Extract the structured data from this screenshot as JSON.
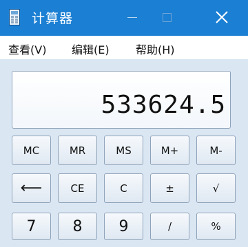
{
  "titlebar": {
    "title": "计算器",
    "icon": "calculator-icon",
    "minimize_icon": "minimize-icon",
    "maximize_icon": "maximize-icon",
    "close_icon": "close-icon"
  },
  "menu": {
    "items": [
      {
        "label": "查看(V)"
      },
      {
        "label": "编辑(E)"
      },
      {
        "label": "帮助(H)"
      }
    ]
  },
  "display": {
    "value": "533624.5"
  },
  "keys": {
    "row1": [
      "MC",
      "MR",
      "MS",
      "M+",
      "M-"
    ],
    "row2": [
      "⟵",
      "CE",
      "C",
      "±",
      "√"
    ],
    "row3": [
      "7",
      "8",
      "9",
      "/",
      "%"
    ]
  },
  "colors": {
    "titlebar": "#1b7fd3",
    "window_body": "#dbe6f3",
    "menubar": "#ffffff"
  }
}
